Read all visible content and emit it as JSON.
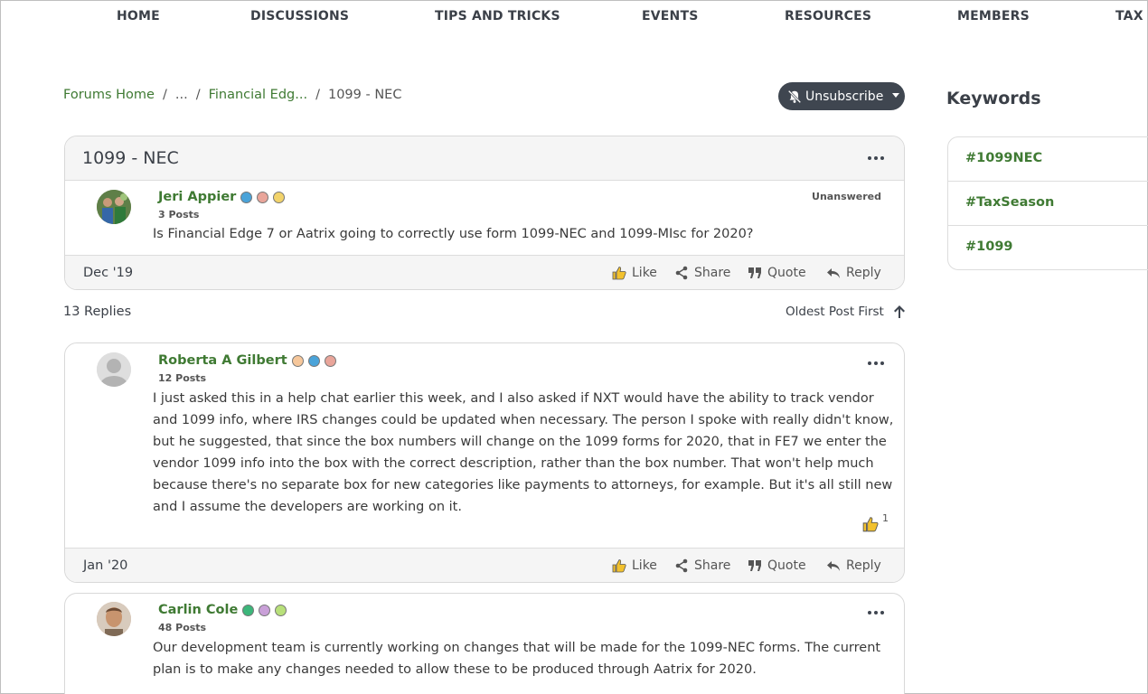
{
  "nav": {
    "items": [
      "HOME",
      "DISCUSSIONS",
      "TIPS AND TRICKS",
      "EVENTS",
      "RESOURCES",
      "MEMBERS",
      "TAX S"
    ]
  },
  "breadcrumb": {
    "forums_home": "Forums Home",
    "ellipsis": "...",
    "category": "Financial Edg...",
    "current": "1099 - NEC",
    "separator": "/"
  },
  "subscribe_button": {
    "label": "Unsubscribe"
  },
  "keywords": {
    "title": "Keywords",
    "items": [
      "#1099NEC",
      "#TaxSeason",
      "#1099"
    ]
  },
  "thread": {
    "title": "1099 - NEC",
    "author": "Jeri Appier",
    "post_count": "3 Posts",
    "status": "Unanswered",
    "body": "Is Financial Edge 7 or Aatrix going to correctly use form 1099-NEC and 1099-MIsc for 2020?",
    "date": "Dec '19"
  },
  "actions": {
    "like": "Like",
    "share": "Share",
    "quote": "Quote",
    "reply": "Reply"
  },
  "replies": {
    "count_label": "13 Replies",
    "sort_label": "Oldest Post First",
    "items": [
      {
        "author": "Roberta A Gilbert",
        "post_count": "12 Posts",
        "body": "I just asked this in a help chat earlier this week, and I also asked if NXT would have the ability to track vendor and 1099 info, where IRS changes could be updated when necessary.  The person I spoke with really didn't know, but he suggested, that since the box numbers will change on the 1099 forms for 2020, that in FE7 we enter the vendor 1099 info into the box with the correct description, rather than the box number.  That won't help much because there's no separate box for new categories like payments to attorneys, for example.  But it's all still new and I assume the developers are working on it.",
        "likes": "1",
        "date": "Jan '20"
      },
      {
        "author": "Carlin Cole",
        "post_count": "48 Posts",
        "body": "Our development team is currently working on changes that will be made for the 1099-NEC forms.  The current plan is to make any changes needed to allow these to be produced through Aatrix for 2020."
      }
    ]
  },
  "colors": {
    "accent_green": "#3f7a33",
    "dark_button": "#3f4650",
    "like_yellow": "#f2c12e"
  }
}
